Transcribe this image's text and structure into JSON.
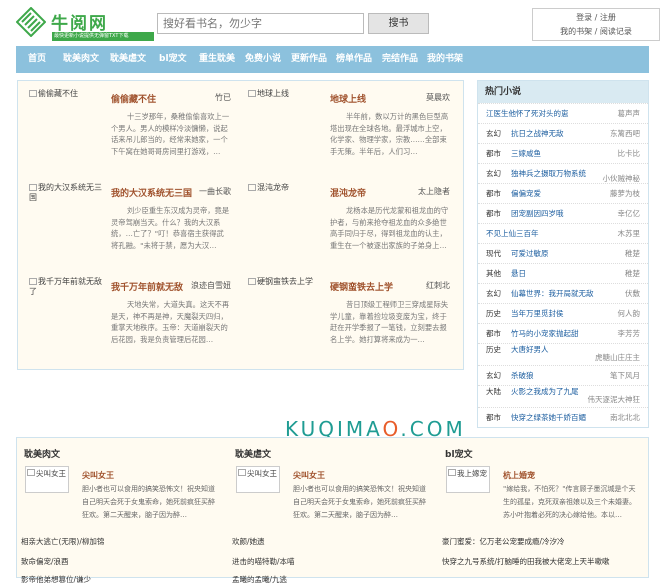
{
  "header": {
    "site_name": "牛阅网",
    "slogan": "最快更新小说提供无弹窗TXT下载",
    "search_placeholder": "搜好看书名，勿少字",
    "search_button": "搜书",
    "login": "登录 / 注册",
    "shelf": "我的书架 / 阅读记录"
  },
  "nav": [
    "首页",
    "耽美肉文",
    "耽美虐文",
    "bl宠文",
    "重生耽美",
    "免费小说",
    "更新作品",
    "榜单作品",
    "完结作品",
    "我的书架"
  ],
  "featured": [
    {
      "img": "偷偷藏不住",
      "title": "偷偷藏不住",
      "author": "竹已",
      "desc": "十三岁那年，桑稚偷偷喜欢上一个男人。男人的模样冷淡慵懒，说起话来吊儿郎当的，经常来她家，一个下午窝在她哥哥房间里打游戏，…"
    },
    {
      "img": "地球上线",
      "title": "地球上线",
      "author": "莫晨欢",
      "desc": "半年前，数以万计的黑色巨型高塔出现在全球各地。最浮城市上空，化学家、物理学家，宗教……全部束手无策。半年后，人们习…"
    },
    {
      "img": "我的大汉系统无三国",
      "title": "我的大汉系统无三国",
      "author": "一曲长歌",
      "desc": "刘少臣重生东汉成为灵帝，竟是灵帝驾崩当天。什么？我的大汉系统，…亡了？\"叮！恭喜宿主获得武将孔融。\"未将于禁，愿为大汉…"
    },
    {
      "img": "混沌龙帝",
      "title": "混沌龙帝",
      "author": "太上隐者",
      "desc": "龙杨本是历代龙蒙和祖龙血的守护者，与前来抢夺祖龙血的众多绝世高手同归于尽，得到祖龙血的认主，重生在一个被逐出家族的子弟身上…"
    },
    {
      "img": "我千万年前就无敌了",
      "title": "我千万年前就无敌",
      "author": "浪迹自雪妞",
      "desc": "天地失常，大道失真。这天不再是天，神不再是神，天魔裂天四归，重掌天地秩序。玉帝：天道崩裂天的后花园，我是负责管理后花园…"
    },
    {
      "img": "硬钢蛮铁去上学",
      "title": "硬钢蛮铁去上学",
      "author": "红刺北",
      "desc": "昔日顶级工程师卫三穿成星际失学儿童，靠着捡垃圾变废为宝，终于赶在开学季报了一笔钱，立刻要去报名上学。她打算将来成为一…"
    }
  ],
  "sidebar": {
    "title": "热门小说",
    "items": [
      {
        "cat": "",
        "title": "江医生他怀了死对头的崽",
        "author": "葛声声"
      },
      {
        "cat": "玄幻",
        "title": "抗日之战神无敌",
        "author": "东篱西吧"
      },
      {
        "cat": "都市",
        "title": "三嫁咸鱼",
        "author": "比卡比"
      },
      {
        "cat": "玄幻",
        "title": "独神兵之摄取万物系统",
        "author": "小伙贼神秘"
      },
      {
        "cat": "都市",
        "title": "偏偏宠爱",
        "author": "藤萝为枝"
      },
      {
        "cat": "都市",
        "title": "团宠副因四岁哦",
        "author": "幸亿亿"
      },
      {
        "cat": "",
        "title": "不见上仙三百年",
        "author": "木苏里"
      },
      {
        "cat": "现代",
        "title": "可爱过敏原",
        "author": "稚楚"
      },
      {
        "cat": "其他",
        "title": "悬日",
        "author": "稚楚"
      },
      {
        "cat": "玄幻",
        "title": "仙幕世界：我开局就无敌",
        "author": "伏敷"
      },
      {
        "cat": "历史",
        "title": "当年万里觅封侯",
        "author": "何人韵"
      },
      {
        "cat": "都市",
        "title": "竹马的小宠家抛起甜",
        "author": "李芳芳"
      },
      {
        "cat": "历史",
        "title": "大唐好男人",
        "author": "虎糖山庄庄主"
      },
      {
        "cat": "玄幻",
        "title": "杀破狼",
        "author": "笔下风月"
      },
      {
        "cat": "大陆",
        "title": "火影之我成为了九尾",
        "author": "伟天逐泥大神狂"
      },
      {
        "cat": "都市",
        "title": "快穿之绿茶她千娇百媚",
        "author": "南北北北"
      }
    ]
  },
  "watermark": {
    "a": "KUQIMA",
    "b": "O",
    "c": ".COM"
  },
  "bottom": [
    {
      "head": "耽美肉文",
      "img": "尖叫女王",
      "title": "尖叫女王",
      "desc": "胆小者也可以食用的搞笑恐怖文！祝央知道自己明天会死于女鬼索命，她死前疯狂买醉狂欢。第二天醒来，脑子因为醉…",
      "links": [
        {
          "t": "相亲大逃亡(无限)",
          "a": "/柳加锦"
        },
        {
          "t": "致命偏宠",
          "a": "/浪酉"
        },
        {
          "t": "影帝他弟想篡位",
          "a": "/谦少"
        }
      ]
    },
    {
      "head": "耽美虐文",
      "img": "尖叫女王",
      "title": "尖叫女王",
      "desc": "胆小者也可以食用的搞笑恐怖文！祝央知道自己明天会死于女鬼索命，她死前疯狂买醉狂欢。第二天醒来，脑子因为醉…",
      "links": [
        {
          "t": "欢颜",
          "a": "/她遗"
        },
        {
          "t": "进击的喵特勒",
          "a": "/本喵"
        },
        {
          "t": "孟曦的孟曦",
          "a": "/九逃"
        }
      ]
    },
    {
      "head": "bl宠文",
      "img": "我上嫁宠",
      "title": "杭上婚宠",
      "desc": "\"嫁给我，不怕死？\"传言顾子墨沉城是个天生的孤星，克死双亲祖娘以及三个未婚妻。苏小叶抱着必死的决心嫁给他。本以…",
      "links": [
        {
          "t": "豪门蜜爱：亿万老公宠要成瘾",
          "a": "/冷汐冷"
        },
        {
          "t": "快穿之九号系统",
          "a": "/打脑睡的田"
        },
        {
          "t": "",
          "a": ""
        }
      ]
    }
  ],
  "bottom_extra": [
    "我被大佬宠上天",
    "半嗽嗽"
  ]
}
